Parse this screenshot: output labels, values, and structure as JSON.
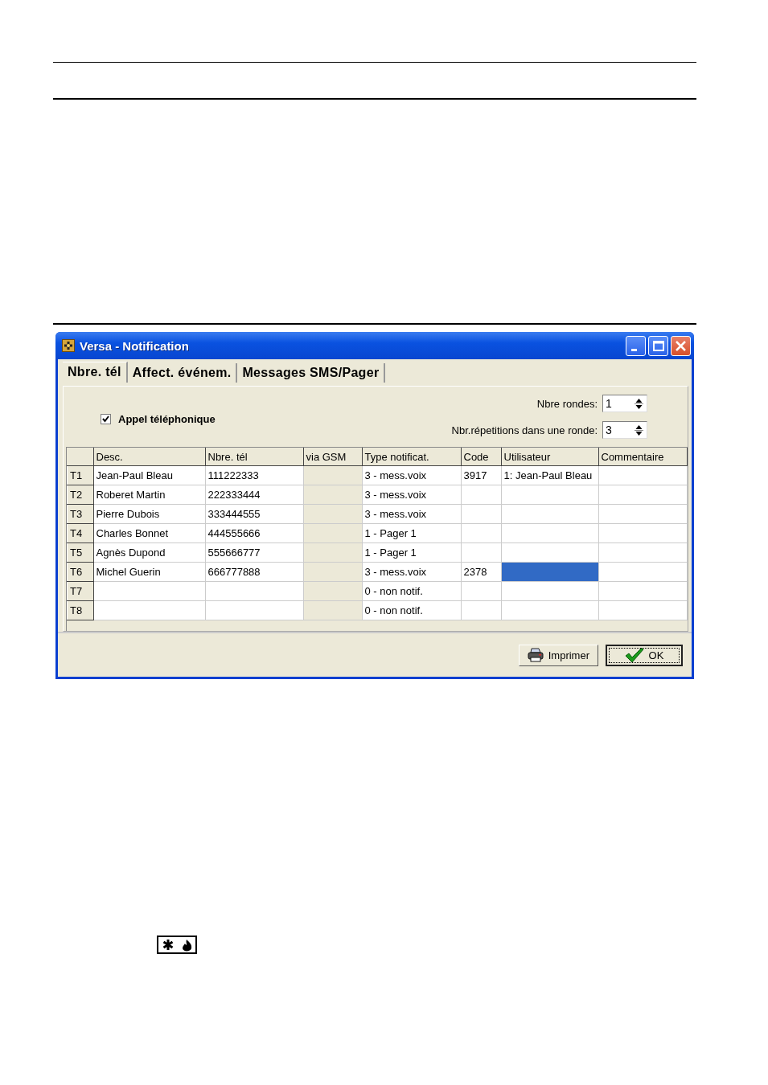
{
  "window": {
    "title": "Versa - Notification"
  },
  "tabs": [
    {
      "label": "Nbre. tél",
      "selected": true
    },
    {
      "label": "Affect. événem.",
      "selected": false
    },
    {
      "label": "Messages SMS/Pager",
      "selected": false
    }
  ],
  "phone_call": {
    "label": "Appel téléphonique",
    "checked": true
  },
  "spinners": [
    {
      "label": "Nbre rondes:",
      "value": "1"
    },
    {
      "label": "Nbr.répetitions dans une ronde:",
      "value": "3"
    }
  ],
  "table": {
    "columns": [
      {
        "label": "Desc.",
        "disabled": false
      },
      {
        "label": "Nbre. tél",
        "disabled": false
      },
      {
        "label": "via GSM",
        "disabled": true
      },
      {
        "label": "Type notificat.",
        "disabled": false
      },
      {
        "label": "Code",
        "disabled": false
      },
      {
        "label": "Utilisateur",
        "disabled": false
      },
      {
        "label": "Commentaire",
        "disabled": false
      }
    ],
    "rows": [
      {
        "header": "T1",
        "cells": [
          {
            "text": "Jean-Paul Bleau",
            "selected": false
          },
          {
            "text": "111222333",
            "selected": false
          },
          {
            "selected": false
          },
          {
            "text": "3 - mess.voix",
            "selected": false
          },
          {
            "text": "3917",
            "selected": false
          },
          {
            "text": "1: Jean-Paul Bleau",
            "selected": false
          },
          {
            "selected": false
          }
        ]
      },
      {
        "header": "T2",
        "cells": [
          {
            "text": "Roberet Martin",
            "selected": false
          },
          {
            "text": "222333444",
            "selected": false
          },
          {
            "selected": false
          },
          {
            "text": "3 - mess.voix",
            "selected": false
          },
          {
            "selected": false
          },
          {
            "selected": false
          },
          {
            "selected": false
          }
        ]
      },
      {
        "header": "T3",
        "cells": [
          {
            "text": "Pierre Dubois",
            "selected": false
          },
          {
            "text": "333444555",
            "selected": false
          },
          {
            "selected": false
          },
          {
            "text": "3 - mess.voix",
            "selected": false
          },
          {
            "selected": false
          },
          {
            "selected": false
          },
          {
            "selected": false
          }
        ]
      },
      {
        "header": "T4",
        "cells": [
          {
            "text": "Charles Bonnet",
            "selected": false
          },
          {
            "text": "444555666",
            "selected": false
          },
          {
            "selected": false
          },
          {
            "text": "1 - Pager 1",
            "selected": false
          },
          {
            "selected": false
          },
          {
            "selected": false
          },
          {
            "selected": false
          }
        ]
      },
      {
        "header": "T5",
        "cells": [
          {
            "text": "Agnès Dupond",
            "selected": false
          },
          {
            "text": "555666777",
            "selected": false
          },
          {
            "selected": false
          },
          {
            "text": "1 - Pager 1",
            "selected": false
          },
          {
            "selected": false
          },
          {
            "selected": false
          },
          {
            "selected": false
          }
        ]
      },
      {
        "header": "T6",
        "cells": [
          {
            "text": "Michel Guerin",
            "selected": false
          },
          {
            "text": "666777888",
            "selected": false
          },
          {
            "selected": false
          },
          {
            "text": "3 - mess.voix",
            "selected": false
          },
          {
            "text": "2378",
            "selected": false
          },
          {
            "selected": true
          },
          {
            "selected": false
          }
        ]
      },
      {
        "header": "T7",
        "cells": [
          {
            "selected": false
          },
          {
            "selected": false
          },
          {
            "selected": false
          },
          {
            "text": "0 - non notif.",
            "selected": false
          },
          {
            "selected": false
          },
          {
            "selected": false
          },
          {
            "selected": false
          }
        ]
      },
      {
        "header": "T8",
        "cells": [
          {
            "selected": false
          },
          {
            "selected": false
          },
          {
            "selected": false
          },
          {
            "text": "0 - non notif.",
            "selected": false
          },
          {
            "selected": false
          },
          {
            "selected": false
          },
          {
            "selected": false
          }
        ]
      }
    ]
  },
  "buttons": [
    {
      "label": "Imprimer",
      "kind": "print",
      "focused": false
    },
    {
      "label": "OK",
      "kind": "ok",
      "focused": true
    }
  ]
}
